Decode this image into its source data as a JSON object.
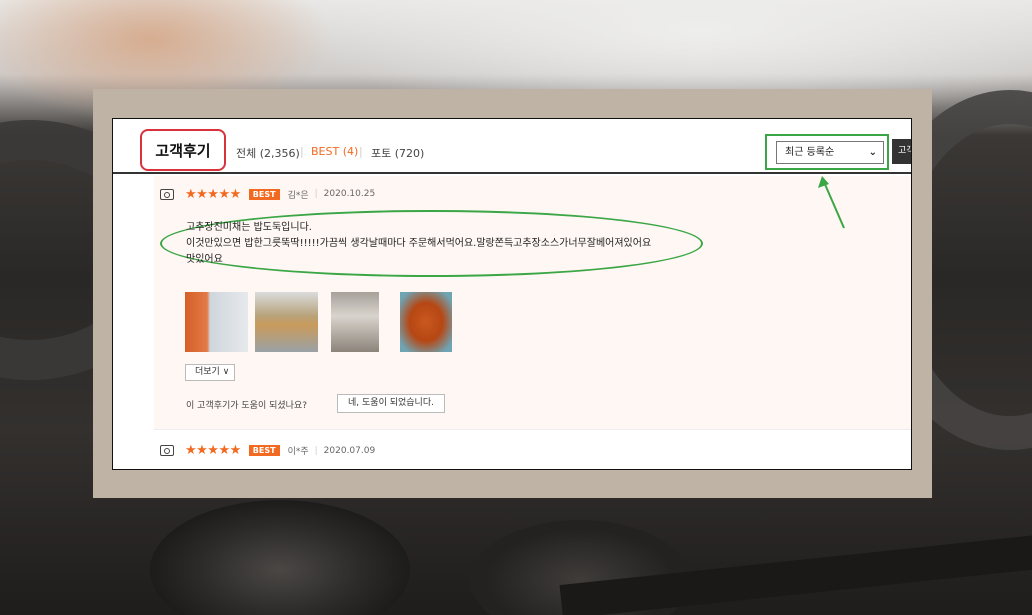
{
  "header": {
    "title": "고객후기",
    "tabs": [
      {
        "label": "전체 (2,356)"
      },
      {
        "label": "BEST (4)"
      },
      {
        "label": "포토 (720)"
      }
    ],
    "sort_label": "최근 등록순",
    "side_button": "고객"
  },
  "reviews": [
    {
      "stars": "★★★★★",
      "badge": "BEST",
      "author": "김*은",
      "date": "2020.10.25",
      "lines": [
        "고추장진미채는 밥도둑입니다.",
        "이것만있으면 밥한그릇뚝딱!!!!!가끔씩 생각날때마다 주문해서먹어요.말랑쫀득고추장소스가너무잘베어져있어요",
        "맛있어요"
      ],
      "more_label": "더보기 ∨",
      "help_question": "이 고객후기가 도움이 되셨나요?",
      "help_button": "네, 도움이 되었습니다."
    },
    {
      "stars": "★★★★★",
      "badge": "BEST",
      "author": "이*주",
      "date": "2020.07.09"
    }
  ],
  "colors": {
    "accent": "#f26a21",
    "highlight_red": "#d8323c",
    "highlight_green": "#3aa645"
  }
}
